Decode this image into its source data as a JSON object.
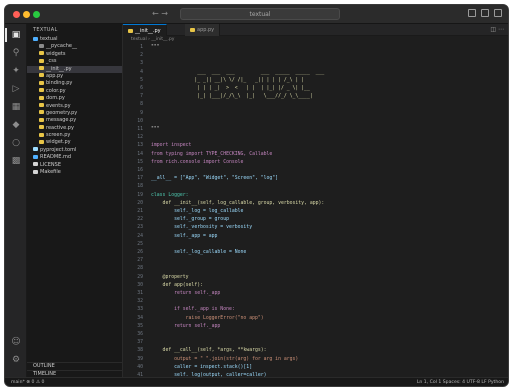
{
  "window": {
    "search_text": "textual",
    "nav_arrows": "← →"
  },
  "sidebar": {
    "header": "TEXTUAL",
    "items": [
      {
        "label": "textual",
        "color": "#4fb0ff",
        "badge": "",
        "indent": 0
      },
      {
        "label": "__pycache__",
        "color": "#8b8b8b",
        "badge": "",
        "indent": 1
      },
      {
        "label": "widgets",
        "color": "#e8c547",
        "badge": "",
        "indent": 1
      },
      {
        "label": "_css",
        "color": "#e8c547",
        "badge": "",
        "indent": 1
      },
      {
        "label": "__init__.py",
        "color": "#e8c547",
        "badge": "",
        "indent": 1,
        "selected": true
      },
      {
        "label": "app.py",
        "color": "#e8c547",
        "badge": "",
        "indent": 1
      },
      {
        "label": "binding.py",
        "color": "#e8c547",
        "badge": "",
        "indent": 1
      },
      {
        "label": "color.py",
        "color": "#e8c547",
        "badge": "",
        "indent": 1
      },
      {
        "label": "dom.py",
        "color": "#e8c547",
        "badge": "",
        "indent": 1
      },
      {
        "label": "events.py",
        "color": "#e8c547",
        "badge": "",
        "indent": 1
      },
      {
        "label": "geometry.py",
        "color": "#e8c547",
        "badge": "",
        "indent": 1
      },
      {
        "label": "message.py",
        "color": "#e8c547",
        "badge": "",
        "indent": 1
      },
      {
        "label": "reactive.py",
        "color": "#e8c547",
        "badge": "",
        "indent": 1
      },
      {
        "label": "screen.py",
        "color": "#e8c547",
        "badge": "",
        "indent": 1
      },
      {
        "label": "widget.py",
        "color": "#e8c547",
        "badge": "",
        "indent": 1
      },
      {
        "label": "pyproject.toml",
        "color": "#9cdcfe",
        "badge": "",
        "indent": 0
      },
      {
        "label": "README.md",
        "color": "#4fb0ff",
        "badge": "",
        "indent": 0
      },
      {
        "label": "LICENSE",
        "color": "#d4d4d4",
        "badge": "",
        "indent": 0
      },
      {
        "label": "Makefile",
        "color": "#d4d4d4",
        "badge": "",
        "indent": 0
      }
    ],
    "bottom": [
      "OUTLINE",
      "TIMELINE"
    ]
  },
  "tabs": [
    {
      "label": "__init__.py",
      "active": true
    },
    {
      "label": "app.py",
      "active": false
    }
  ],
  "breadcrumb": "textual › __init__.py",
  "code_lines": [
    {
      "text": "\"\"\"",
      "cls": ""
    },
    {
      "text": "",
      "cls": ""
    },
    {
      "text": "",
      "cls": ""
    },
    {
      "text": "                ___  ___  ___         ___  _____  _____  ___",
      "cls": "art"
    },
    {
      "text": "               |_ _|| __|\\ \\/ /|_   _|| | | | /_\\ | |",
      "cls": "art"
    },
    {
      "text": "                | | | _|  >  <   | |  | |_| |/ _ \\| |__",
      "cls": "art"
    },
    {
      "text": "                |_| |___|/_/\\_\\  |_|   \\___//_/ \\_\\____|",
      "cls": "art"
    },
    {
      "text": "",
      "cls": ""
    },
    {
      "text": "",
      "cls": ""
    },
    {
      "text": "",
      "cls": ""
    },
    {
      "text": "\"\"\"",
      "cls": ""
    },
    {
      "text": "",
      "cls": ""
    },
    {
      "text": "import inspect",
      "cls": "kw"
    },
    {
      "text": "from typing import TYPE_CHECKING, Callable",
      "cls": "kw"
    },
    {
      "text": "from rich.console import Console",
      "cls": "kw"
    },
    {
      "text": "",
      "cls": ""
    },
    {
      "text": "__all__ = [\"App\", \"Widget\", \"Screen\", \"log\"]",
      "cls": "var"
    },
    {
      "text": "",
      "cls": ""
    },
    {
      "text": "class Logger:",
      "cls": "cls"
    },
    {
      "text": "    def __init__(self, log_callable, group, verbosity, app):",
      "cls": "fn"
    },
    {
      "text": "        self._log = log_callable",
      "cls": "var"
    },
    {
      "text": "        self._group = group",
      "cls": "var"
    },
    {
      "text": "        self._verbosity = verbosity",
      "cls": "var"
    },
    {
      "text": "        self._app = app",
      "cls": "var"
    },
    {
      "text": "",
      "cls": ""
    },
    {
      "text": "        self._log_callable = None",
      "cls": "var"
    },
    {
      "text": "",
      "cls": ""
    },
    {
      "text": "",
      "cls": ""
    },
    {
      "text": "    @property",
      "cls": "dec"
    },
    {
      "text": "    def app(self):",
      "cls": "fn"
    },
    {
      "text": "        return self._app",
      "cls": "kw"
    },
    {
      "text": "",
      "cls": ""
    },
    {
      "text": "        if self._app is None:",
      "cls": "kw"
    },
    {
      "text": "            raise LoggerError(\"no app\")",
      "cls": "str"
    },
    {
      "text": "        return self._app",
      "cls": "kw"
    },
    {
      "text": "",
      "cls": ""
    },
    {
      "text": "",
      "cls": ""
    },
    {
      "text": "    def __call__(self, *args, **kwargs):",
      "cls": "fn"
    },
    {
      "text": "        output = \" \".join(str(arg) for arg in args)",
      "cls": "str"
    },
    {
      "text": "        caller = inspect.stack()[1]",
      "cls": "var"
    },
    {
      "text": "        self._log(output, caller=caller)",
      "cls": "var"
    }
  ],
  "status": {
    "left": "main*   ⊗ 0  ⚠ 0",
    "right": "Ln 1, Col 1   Spaces: 4   UTF-8   LF   Python"
  }
}
